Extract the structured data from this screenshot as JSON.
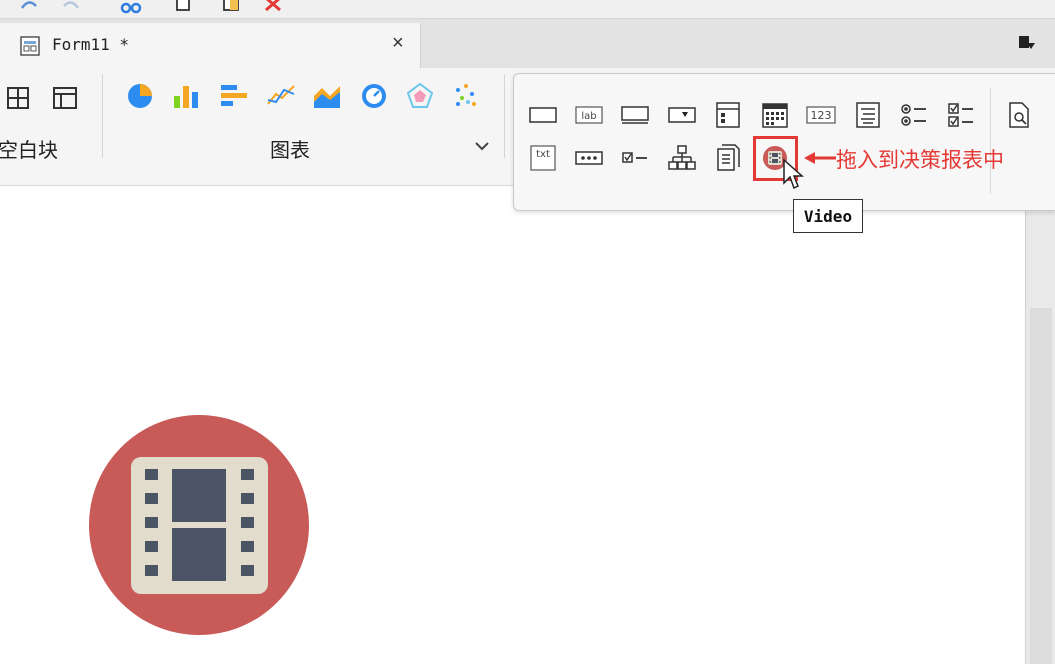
{
  "tab": {
    "title": "Form11 *",
    "close_glyph": "×"
  },
  "ribbon": {
    "group_blank_label": "空白块",
    "group_chart_label": "图表"
  },
  "widget_panel": {
    "tooltip": "Video",
    "annotation": "拖入到决策报表中",
    "row1": [
      "button-widget-icon",
      "label-widget-icon",
      "textbox-widget-icon",
      "dropdown-widget-icon",
      "date-widget-icon",
      "calendar-widget-icon",
      "number-widget-icon",
      "list-widget-icon",
      "radio-group-widget-icon",
      "checkbox-group-widget-icon",
      "preview-widget-icon"
    ],
    "row2": [
      "text-area-widget-icon",
      "password-widget-icon",
      "checkbox-widget-icon",
      "tree-widget-icon",
      "file-widget-icon",
      "video-widget-icon"
    ]
  },
  "colors": {
    "accent_red": "#e53935",
    "video_circle": "#c85a58",
    "film_body": "#e1dccb",
    "film_frame": "#4b5565"
  }
}
